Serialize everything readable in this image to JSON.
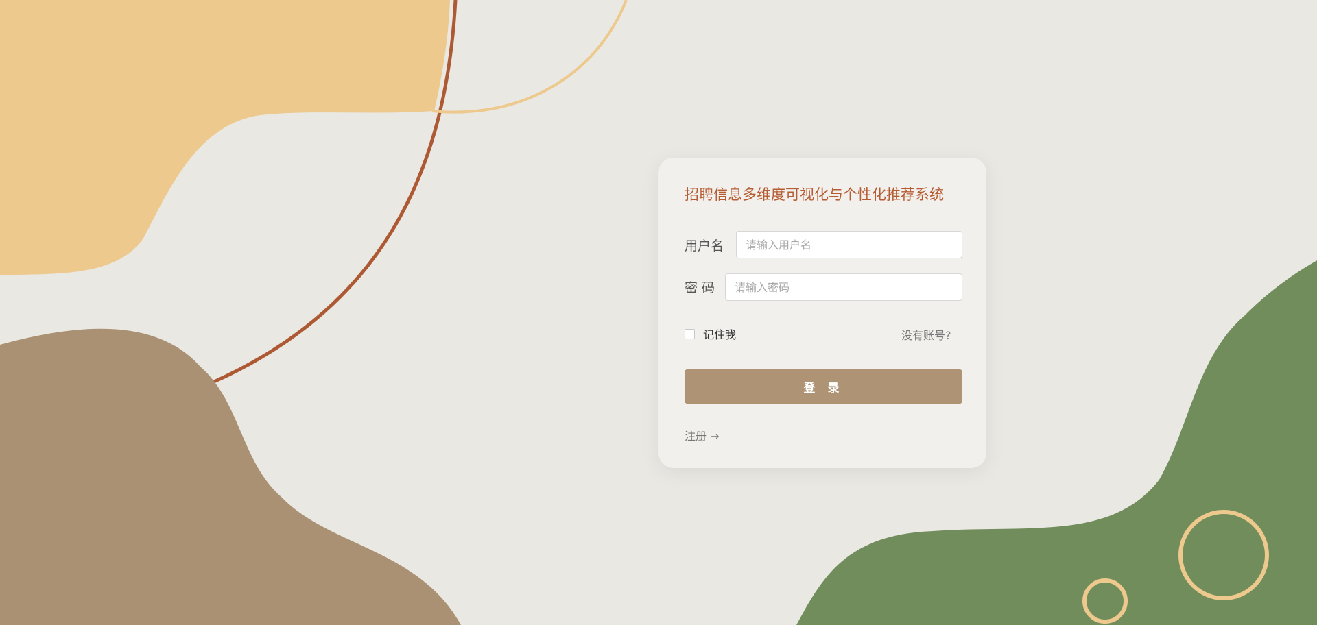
{
  "login": {
    "title": "招聘信息多维度可视化与个性化推荐系统",
    "username_label": "用户名",
    "username_placeholder": "请输入用户名",
    "username_value": "",
    "password_label": "密 码",
    "password_placeholder": "请输入密码",
    "password_value": "",
    "remember_label": "记住我",
    "remember_checked": false,
    "no_account_link": "没有账号?",
    "login_button": "登 录",
    "register_link": "注册 →"
  },
  "colors": {
    "background": "#e9e8e3",
    "title_accent": "#b65c33",
    "button": "#ae9475",
    "blob_yellow": "#edc98d",
    "blob_brown": "#ab9173",
    "blob_green": "#728d5c",
    "stroke_rust": "#ad5a34"
  }
}
